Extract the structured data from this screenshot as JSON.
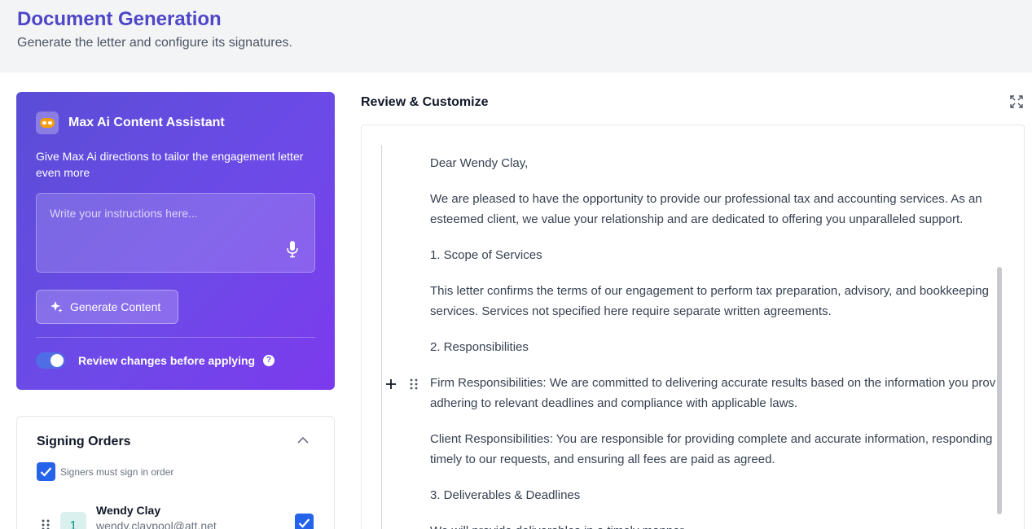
{
  "header": {
    "title": "Document Generation",
    "subtitle": "Generate the letter and configure its signatures."
  },
  "ai_assistant": {
    "title": "Max Ai Content Assistant",
    "description": "Give Max Ai directions to tailor the engagement letter even more",
    "input_placeholder": "Write your instructions here...",
    "input_value": "",
    "generate_label": "Generate Content",
    "toggle_label": "Review changes before applying",
    "toggle_on": true,
    "icons": {
      "logo": "robot-icon",
      "mic": "microphone-icon",
      "generate": "sparkle-icon",
      "help": "question-icon"
    }
  },
  "signing_orders": {
    "title": "Signing Orders",
    "order_checkbox_label": "Signers must sign in order",
    "order_checked": true,
    "signers": [
      {
        "order": "1",
        "name": "Wendy Clay",
        "email": "wendy.claypool@att.net",
        "checked": true
      }
    ]
  },
  "review": {
    "title": "Review & Customize",
    "paragraphs": [
      [
        "Dear Wendy Clay,"
      ],
      [
        "We are pleased to have the opportunity to provide our professional tax and accounting services. As an",
        "esteemed client, we value your relationship and are dedicated to offering you unparalleled support."
      ],
      [
        "1. Scope of Services"
      ],
      [
        "This letter confirms the terms of our engagement to perform tax preparation, advisory, and bookkeeping",
        "services. Services not specified here require separate written agreements."
      ],
      [
        "2. Responsibilities"
      ],
      [
        "Firm Responsibilities: We are committed to delivering accurate results based on the information you provide,",
        "adhering to relevant deadlines and compliance with applicable laws."
      ],
      [
        "Client Responsibilities: You are responsible for providing complete and accurate information, responding",
        "timely to our requests, and ensuring all fees are paid as agreed."
      ],
      [
        "3. Deliverables & Deadlines"
      ],
      [
        "We will provide deliverables in a timely manner"
      ]
    ]
  },
  "colors": {
    "brand_title": "#4f46c8",
    "card_gradient_start": "#5a4dd6",
    "card_gradient_end": "#7c3aed",
    "checkbox": "#2563eb",
    "badge_bg": "#d9f0ee",
    "badge_text": "#0d9488"
  }
}
